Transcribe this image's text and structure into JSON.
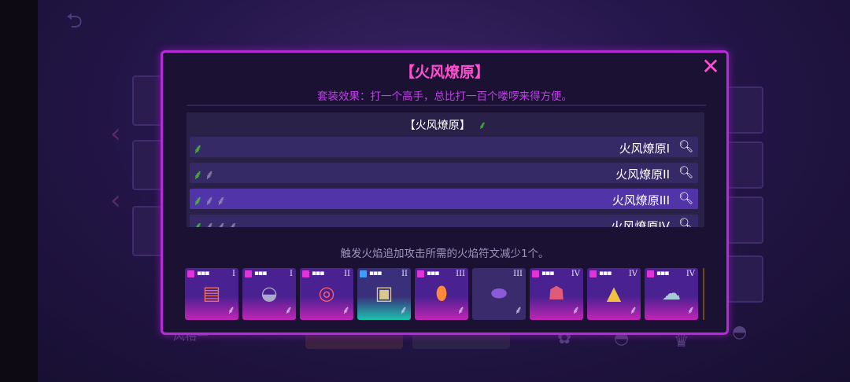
{
  "background": {
    "style_label": "风格一",
    "back_icon": "back-arrow-icon"
  },
  "dialog": {
    "title": "【火风燎原】",
    "subtitle": "套装效果：打一个高手，总比打一百个喽啰来得方便。",
    "close_icon": "close-icon",
    "set_header": "【火风燎原】",
    "set_rows": [
      {
        "leaves_on": 1,
        "leaves_off": 0,
        "name": "火风燎原I",
        "selected": false
      },
      {
        "leaves_on": 1,
        "leaves_off": 1,
        "name": "火风燎原II",
        "selected": false
      },
      {
        "leaves_on": 1,
        "leaves_off": 2,
        "name": "火风燎原III",
        "selected": true
      },
      {
        "leaves_on": 1,
        "leaves_off": 3,
        "name": "火风燎原IV",
        "selected": false
      }
    ],
    "description": "触发火焰追加攻击所需的火焰符文减少1个。",
    "items": [
      {
        "tier": "I",
        "icon": "card-frame-icon",
        "style": "pink",
        "badge": "pink"
      },
      {
        "tier": "I",
        "icon": "ufo-icon",
        "style": "pink",
        "badge": "pink"
      },
      {
        "tier": "II",
        "icon": "life-ring-icon",
        "style": "pink",
        "badge": "pink"
      },
      {
        "tier": "II",
        "icon": "camera-icon",
        "style": "teal",
        "badge": "blue"
      },
      {
        "tier": "III",
        "icon": "lantern-icon",
        "style": "pink",
        "badge": "pink"
      },
      {
        "tier": "III",
        "icon": "gem-icon",
        "style": "plain",
        "badge": "none"
      },
      {
        "tier": "IV",
        "icon": "monster-icon",
        "style": "pink",
        "badge": "pink"
      },
      {
        "tier": "IV",
        "icon": "triangle-charm-icon",
        "style": "pink",
        "badge": "pink"
      },
      {
        "tier": "IV",
        "icon": "ghost-icon",
        "style": "pink",
        "badge": "pink"
      }
    ]
  },
  "colors": {
    "accent": "#ff4fd0",
    "border": "#b52bd6",
    "leaf_active": "#48d12f",
    "row_selected": "#5034a8"
  }
}
